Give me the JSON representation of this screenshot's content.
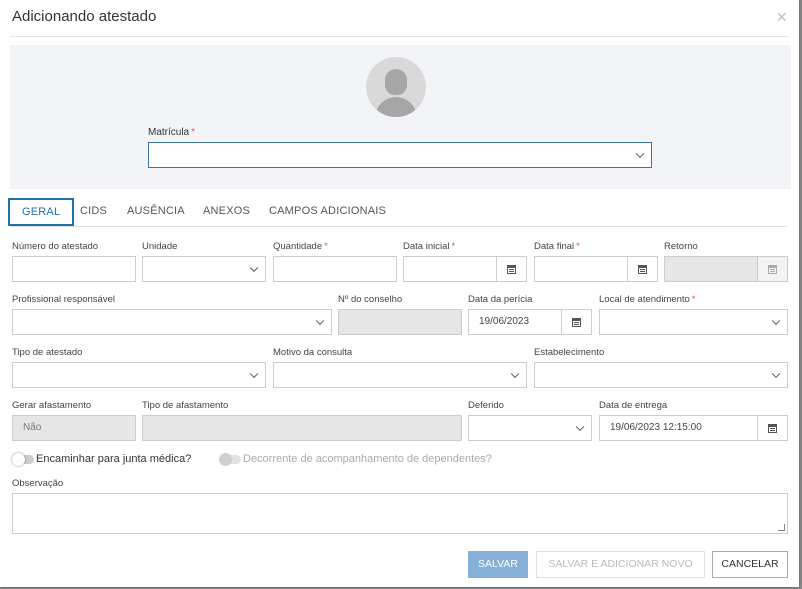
{
  "dialog": {
    "title": "Adicionando atestado",
    "close_symbol": "×"
  },
  "matricula": {
    "label": "Matrícula",
    "required_mark": "*",
    "value": ""
  },
  "tabs": [
    "GERAL",
    "CIDS",
    "AUSÊNCIA",
    "ANEXOS",
    "CAMPOS ADICIONAIS"
  ],
  "form": {
    "numero_atestado": {
      "label": "Número do atestado",
      "value": ""
    },
    "unidade": {
      "label": "Unidade",
      "value": ""
    },
    "quantidade": {
      "label": "Quantidade",
      "value": ""
    },
    "data_inicial": {
      "label": "Data inicial",
      "value": ""
    },
    "data_final": {
      "label": "Data final",
      "value": ""
    },
    "retorno": {
      "label": "Retorno",
      "value": ""
    },
    "profissional": {
      "label": "Profissional responsável",
      "value": ""
    },
    "n_conselho": {
      "label": "Nº do conselho",
      "value": ""
    },
    "data_pericia": {
      "label": "Data da perícia",
      "value": "19/06/2023"
    },
    "local_atendimento": {
      "label": "Local de atendimento",
      "value": ""
    },
    "tipo_atestado": {
      "label": "Tipo de atestado",
      "value": ""
    },
    "motivo_consulta": {
      "label": "Motivo da consulta",
      "value": ""
    },
    "estabelecimento": {
      "label": "Estabelecimento",
      "value": ""
    },
    "gerar_afastamento": {
      "label": "Gerar afastamento",
      "value": "Não"
    },
    "tipo_afastamento": {
      "label": "Tipo de afastamento",
      "value": ""
    },
    "deferido": {
      "label": "Deferido",
      "value": ""
    },
    "data_entrega": {
      "label": "Data de entrega",
      "value": "19/06/2023 12:15:00"
    },
    "required_mark": "*"
  },
  "toggles": {
    "junta_medica": {
      "label": "Encaminhar para junta médica?",
      "checked": false
    },
    "dependentes": {
      "label": "Decorrente de acompanhamento de dependentes?",
      "checked": false,
      "disabled": true
    }
  },
  "observacao": {
    "label": "Observação",
    "value": ""
  },
  "buttons": {
    "save": "SALVAR",
    "save_new": "SALVAR E ADICIONAR NOVO",
    "cancel": "CANCELAR"
  },
  "colors": {
    "accent": "#1f6fa8",
    "required": "#d9534f",
    "save_bg": "#87b0d9",
    "panel_bg": "#f2f4f8"
  }
}
